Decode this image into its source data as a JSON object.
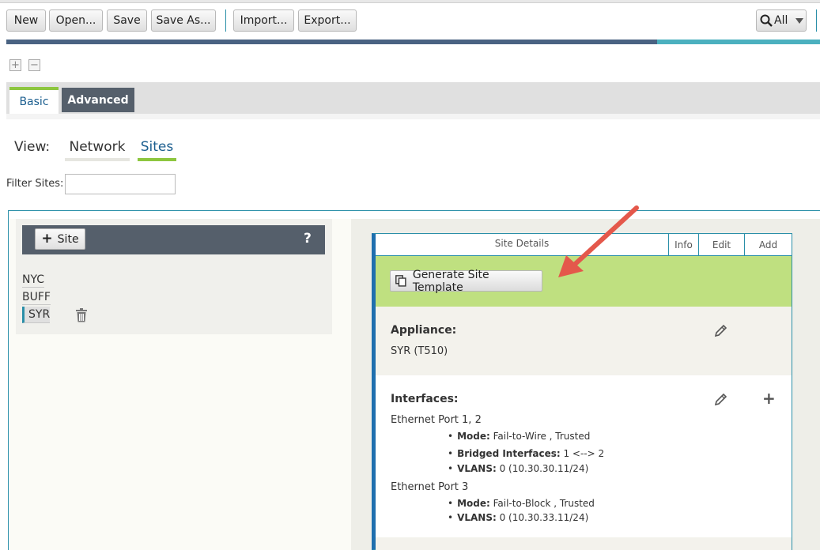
{
  "toolbar": {
    "new_label": "New",
    "open_label": "Open...",
    "save_label": "Save",
    "save_as_label": "Save As...",
    "import_label": "Import...",
    "export_label": "Export...",
    "search_scope": "All"
  },
  "progress": {
    "fraction": 0.8
  },
  "tabs": {
    "basic": "Basic",
    "advanced": "Advanced"
  },
  "view": {
    "label": "View:",
    "network": "Network",
    "sites": "Sites"
  },
  "filter": {
    "label": "Filter Sites:",
    "value": ""
  },
  "sites": {
    "add_label": "Site",
    "help": "?",
    "items": [
      "NYC",
      "BUFF",
      "SYR"
    ],
    "selected": "SYR"
  },
  "details": {
    "title": "Site Details",
    "tabs": [
      "Info",
      "Edit",
      "Add"
    ],
    "generate_label": "Generate Site Template",
    "appliance": {
      "heading": "Appliance:",
      "value": "SYR (T510)"
    },
    "interfaces": {
      "heading": "Interfaces:",
      "ports": [
        {
          "name": "Ethernet Port 1, 2",
          "props": [
            {
              "key": "Mode:",
              "value": " Fail-to-Wire , Trusted"
            },
            {
              "key": "Bridged Interfaces:",
              "value": " 1 <--> 2"
            },
            {
              "key": "VLANS:",
              "value": " 0 (10.30.30.11/24)"
            }
          ]
        },
        {
          "name": "Ethernet Port 3",
          "props": [
            {
              "key": "Mode:",
              "value": " Fail-to-Block , Trusted"
            },
            {
              "key": "VLANS:",
              "value": " 0 (10.30.33.11/24)"
            }
          ]
        }
      ]
    }
  },
  "colors": {
    "accent": "#8dc63f",
    "dark_header": "#555f6b",
    "link_blue": "#1b5e8f",
    "teal": "#2a8fa8",
    "annotation_arrow": "#e4584b"
  }
}
